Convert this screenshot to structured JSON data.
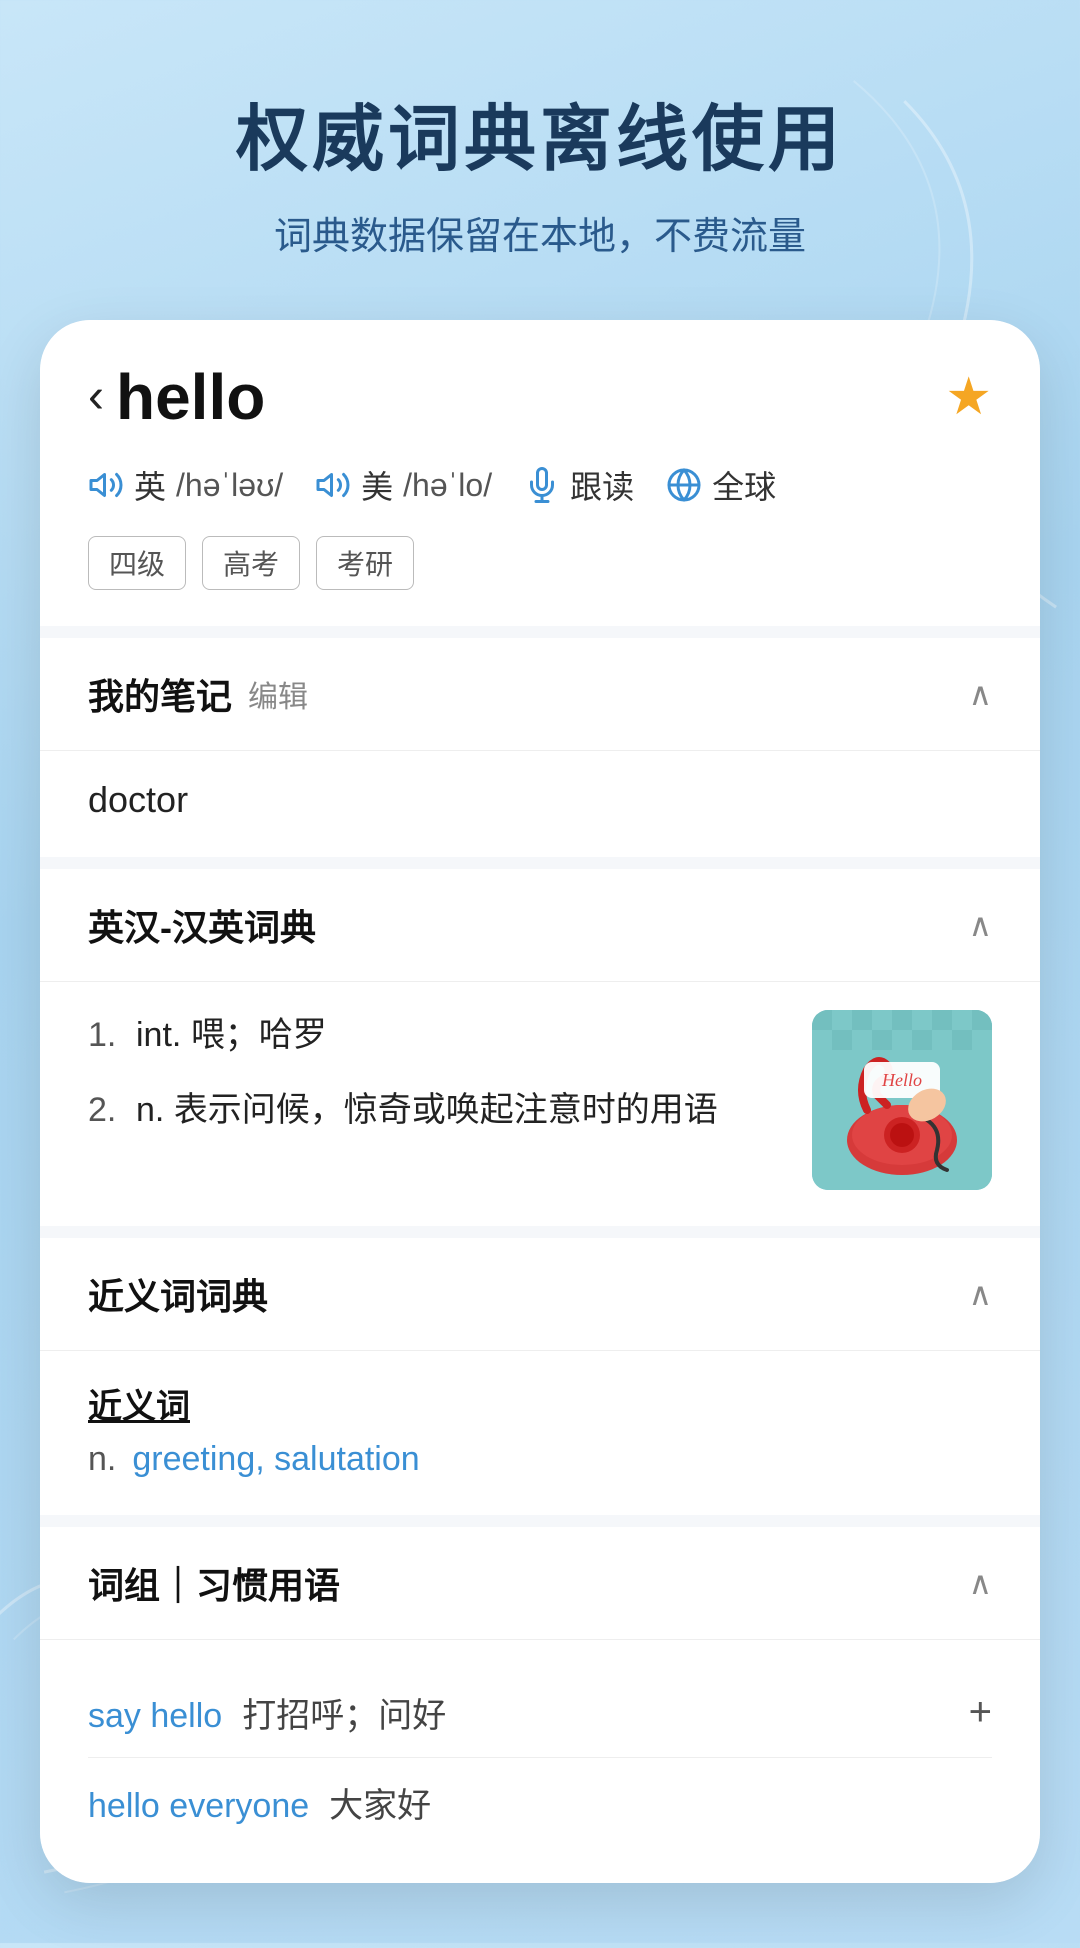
{
  "hero": {
    "title": "权威词典离线使用",
    "subtitle": "词典数据保留在本地，不费流量"
  },
  "word": {
    "back_label": "‹",
    "title": "hello",
    "star_filled": true,
    "pronunciations": [
      {
        "label": "英",
        "phonetic": "/həˈləʊ/"
      },
      {
        "label": "美",
        "phonetic": "/həˈlo/"
      }
    ],
    "follow_read": "跟读",
    "global": "全球",
    "tags": [
      "四级",
      "高考",
      "考研"
    ]
  },
  "sections": {
    "my_notes": {
      "title": "我的笔记",
      "edit": "编辑",
      "content": "doctor"
    },
    "en_zh_dict": {
      "title": "英汉-汉英词典",
      "entries": [
        {
          "num": "1.",
          "pos": "int.",
          "text": "喂；哈罗"
        },
        {
          "num": "2.",
          "pos": "n.",
          "text": "表示问候，惊奇或唤起注意时的用语"
        }
      ]
    },
    "synonyms": {
      "title": "近义词词典",
      "word_label": "近义词",
      "pos": "n.",
      "words": "greeting, salutation"
    },
    "phrases": {
      "title": "词组｜习惯用语",
      "items": [
        {
          "word": "say hello",
          "meaning": "打招呼；问好"
        },
        {
          "word": "hello everyone",
          "meaning": "大家好"
        }
      ]
    }
  },
  "colors": {
    "accent_blue": "#3a8fd4",
    "star_yellow": "#f5a623",
    "tag_border": "#bbb",
    "section_bg": "#f5f7fa",
    "text_dark": "#1a3a5c"
  }
}
